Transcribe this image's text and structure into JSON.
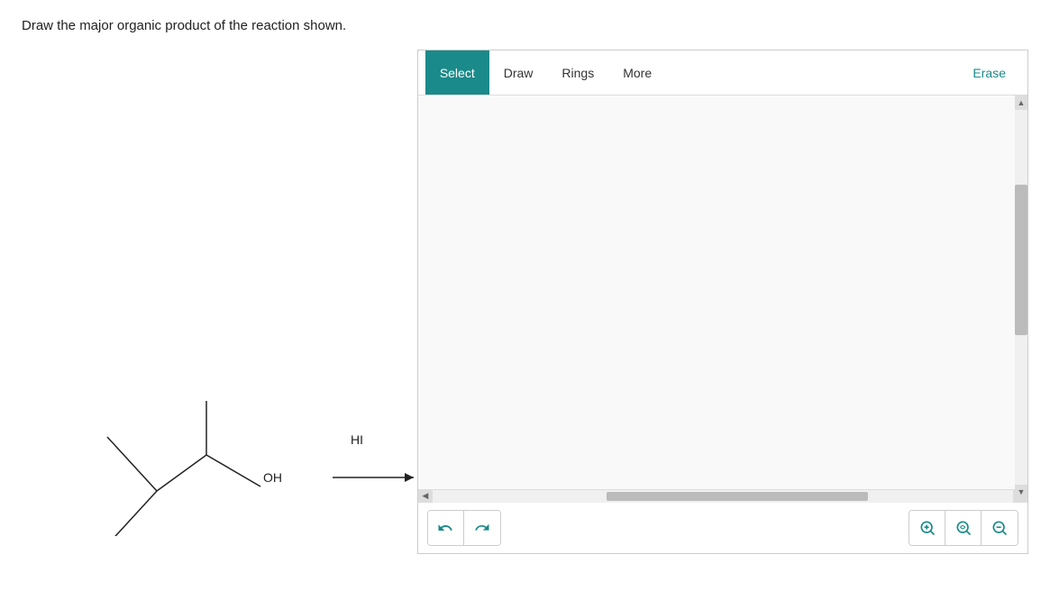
{
  "question": {
    "text": "Draw the major organic product of the reaction shown."
  },
  "toolbar": {
    "buttons": [
      {
        "id": "select",
        "label": "Select",
        "active": true
      },
      {
        "id": "draw",
        "label": "Draw",
        "active": false
      },
      {
        "id": "rings",
        "label": "Rings",
        "active": false
      },
      {
        "id": "more",
        "label": "More",
        "active": false
      }
    ],
    "erase_label": "Erase"
  },
  "controls": {
    "undo_label": "↩",
    "redo_label": "↻",
    "zoom_in_label": "🔍+",
    "zoom_fit_label": "🔍~",
    "zoom_out_label": "🔍-"
  },
  "molecule": {
    "reagent": "HI"
  },
  "colors": {
    "active_tab": "#1a8a8a",
    "erase_color": "#1a8a8a",
    "border": "#ccc",
    "zoom_color": "#1a8a8a"
  }
}
